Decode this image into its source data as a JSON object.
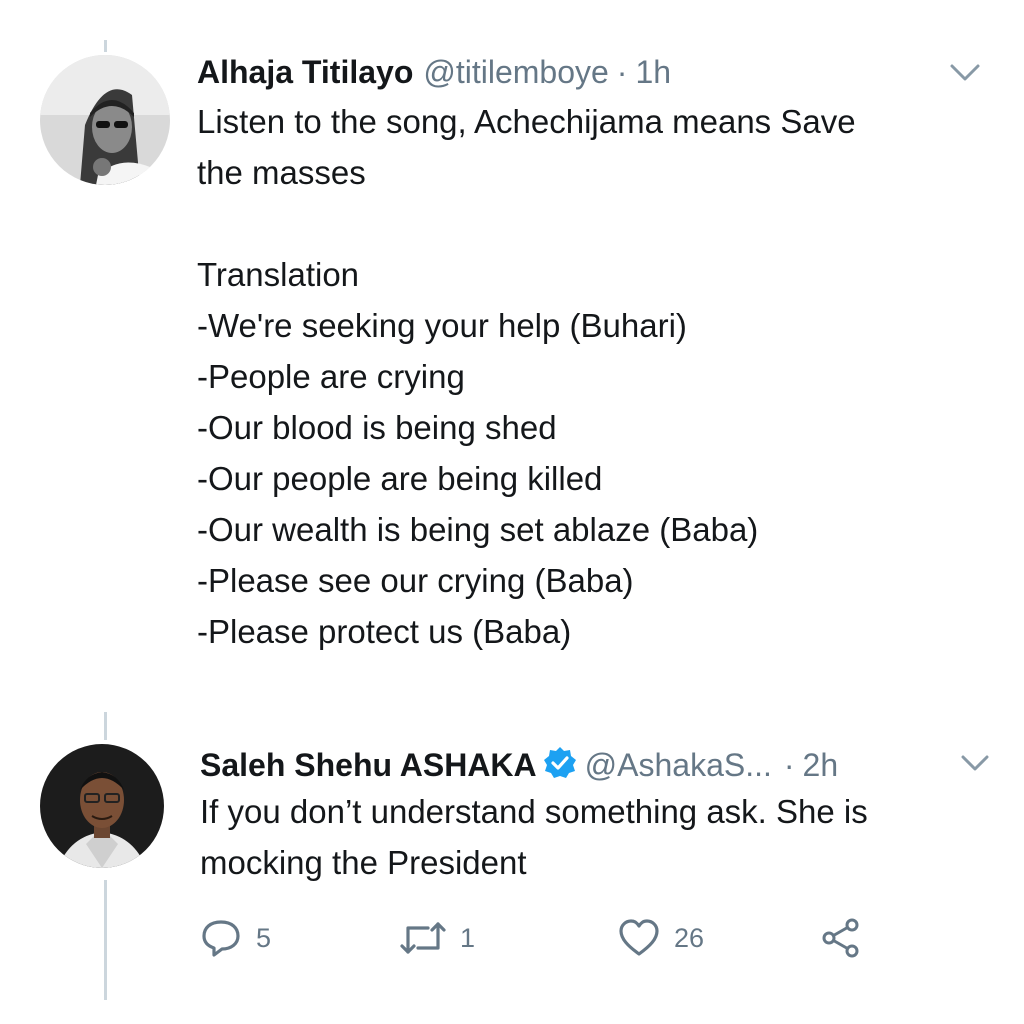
{
  "tweets": [
    {
      "name": "Alhaja Titilayo",
      "handle": "@titilemboye",
      "sep": "·",
      "time": "1h",
      "verified": false,
      "lines": [
        "Listen to the song, Achechijama means Save",
        "the masses",
        "",
        "Translation",
        "-We're seeking your help (Buhari)",
        "-People are crying",
        "-Our blood is being shed",
        "-Our people are being killed",
        "-Our wealth is being set ablaze (Baba)",
        "-Please see our crying (Baba)",
        "-Please protect us  (Baba)"
      ]
    },
    {
      "name": "Saleh Shehu ASHAKA",
      "handle": "@AshakaS...",
      "sep": "·",
      "time": "2h",
      "verified": true,
      "lines": [
        "If you don’t understand something ask. She is",
        "mocking the President"
      ],
      "actions": {
        "reply_count": "5",
        "retweet_count": "1",
        "like_count": "26"
      }
    }
  ],
  "colors": {
    "text": "#14171a",
    "secondary": "#657786",
    "verified": "#1da1f2",
    "thread_line": "#ccd6dd"
  },
  "icons": [
    "chevron-down-icon",
    "verified-badge-icon",
    "reply-icon",
    "retweet-icon",
    "like-icon",
    "share-icon"
  ]
}
